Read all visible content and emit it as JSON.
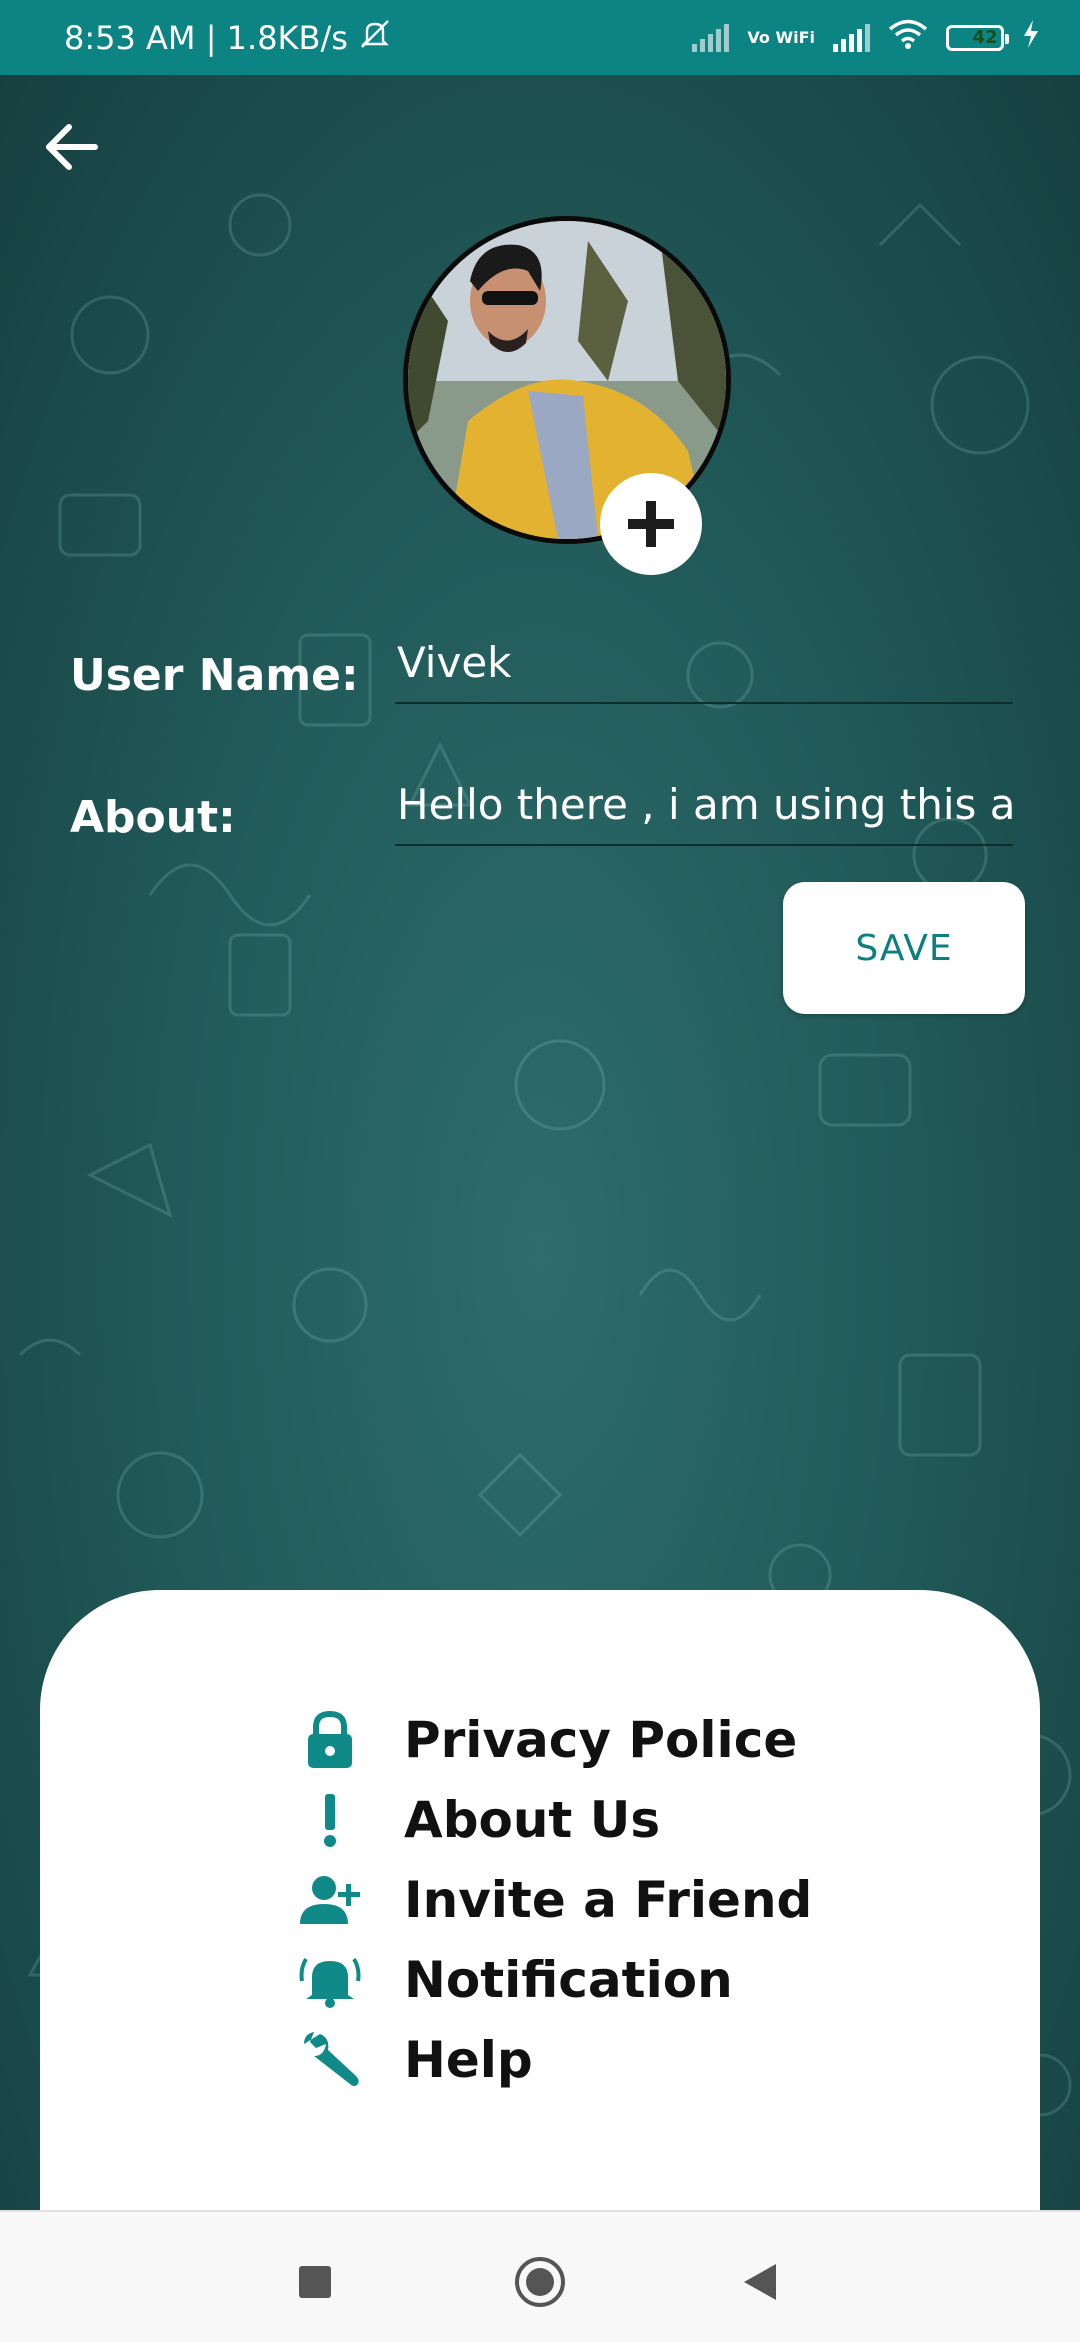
{
  "status_bar": {
    "time_speed": "8:53 AM | 1.8KB/s",
    "network_label": "Vo WiFi",
    "battery_level": "42",
    "battery_fraction": 0.42,
    "icons": [
      "mute-icon",
      "signal-icon",
      "vowifi-icon",
      "wifi-icon",
      "battery-icon",
      "charging-icon"
    ]
  },
  "header": {
    "back_icon": "arrow-left-icon"
  },
  "profile": {
    "avatar_icon": "profile-photo",
    "add_photo_icon": "plus-icon"
  },
  "form": {
    "username_label": "User Name:",
    "username_value": "Vivek",
    "about_label": "About:",
    "about_value": "Hello there , i am using this a"
  },
  "save_label": "SAVE",
  "menu": {
    "items": [
      {
        "label": "Privacy Police",
        "icon": "lock-icon"
      },
      {
        "label": "About Us",
        "icon": "exclamation-icon"
      },
      {
        "label": "Invite a Friend",
        "icon": "person-add-icon"
      },
      {
        "label": "Notification",
        "icon": "bell-icon"
      },
      {
        "label": "Help",
        "icon": "wrench-icon"
      }
    ]
  },
  "nav": {
    "buttons": [
      "recents-square-icon",
      "home-circle-icon",
      "back-triangle-icon"
    ]
  },
  "colors": {
    "accent": "#0c8483",
    "background": "#1f5a5a",
    "card": "#ffffff",
    "icon_teal": "#0f8a88",
    "menu_text": "#111111"
  }
}
